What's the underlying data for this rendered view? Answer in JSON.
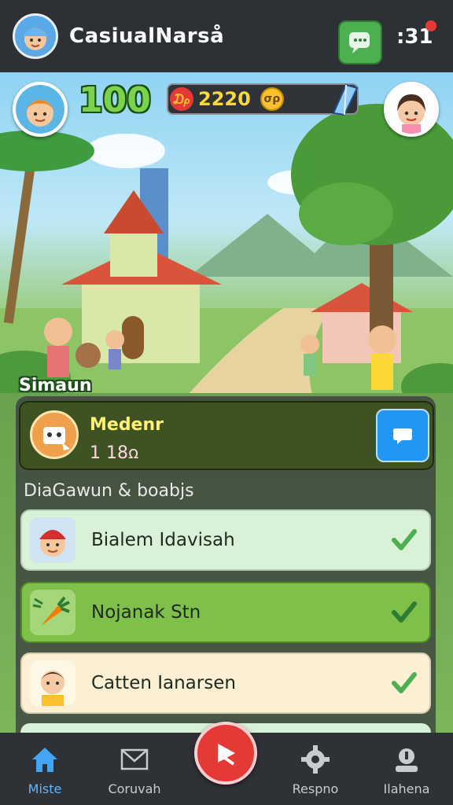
{
  "app": {
    "title": "CasiualNarså",
    "time": ":31"
  },
  "hud": {
    "score": "100",
    "coins": "2220",
    "ruby_symbol": "₯",
    "coin_symbol": "σρ"
  },
  "scene": {
    "location_label": "Simaun"
  },
  "featured": {
    "name": "Medenr",
    "stat": "1 18ꭥ"
  },
  "section": {
    "title": "DiaGawun & boabjs"
  },
  "friends": [
    {
      "name": "Bialem Idavisah"
    },
    {
      "name": "Nojanak Stn"
    },
    {
      "name": "Catten Ianarsen"
    }
  ],
  "nav": [
    {
      "label": "Miste",
      "icon": "home-icon"
    },
    {
      "label": "Coruvah",
      "icon": "mail-icon"
    },
    {
      "label": "",
      "icon": "play-icon"
    },
    {
      "label": "Respno",
      "icon": "gear-icon"
    },
    {
      "label": "Ilahena",
      "icon": "profile-icon"
    }
  ],
  "colors": {
    "accent_green": "#7bd34b",
    "play_red": "#e53935",
    "nav_active": "#64b5f6"
  }
}
